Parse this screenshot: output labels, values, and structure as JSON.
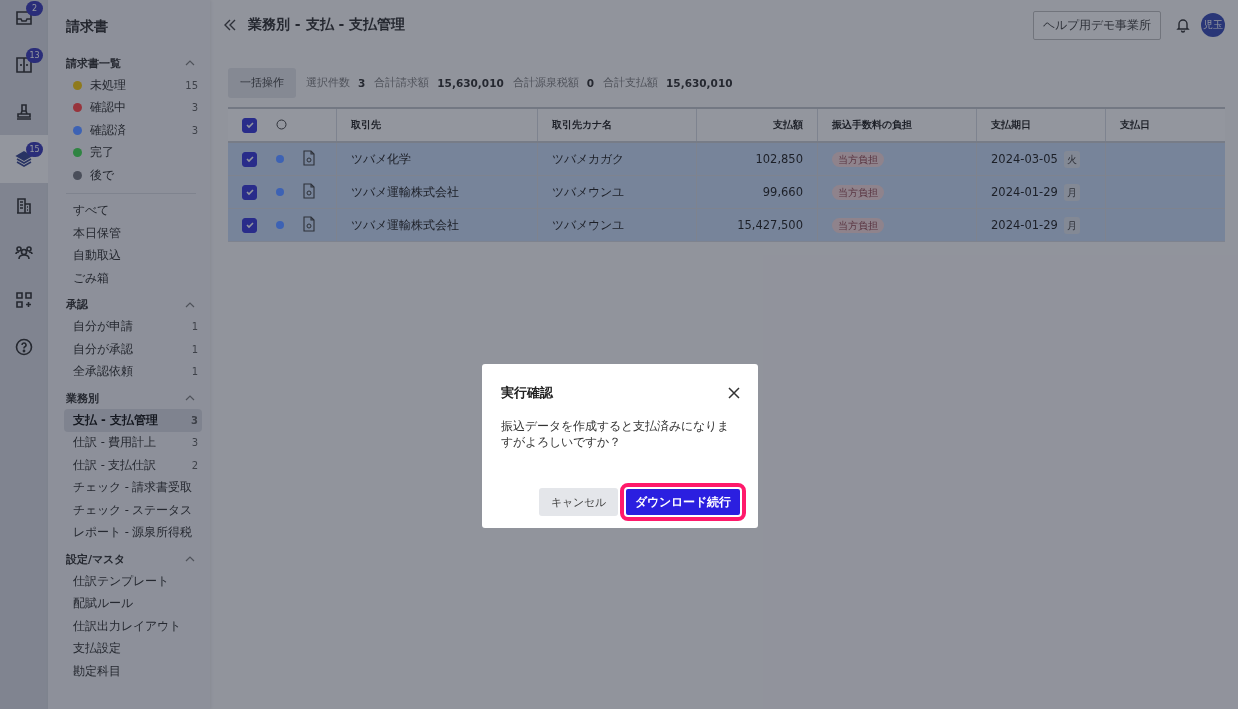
{
  "rail": [
    {
      "badge": "2",
      "selected": false
    },
    {
      "badge": "13",
      "selected": false
    },
    {
      "selected": false
    },
    {
      "badge": "15",
      "selected": true
    },
    {
      "selected": false
    },
    {
      "selected": false
    },
    {
      "selected": false
    },
    {
      "selected": false
    }
  ],
  "sidebar": {
    "title": "請求書",
    "sections": [
      {
        "title": "請求書一覧",
        "expanded": true,
        "items": [
          {
            "kind": "status",
            "label": "未処理",
            "count": "15",
            "color": "#8f7a1c",
            "selected": false
          },
          {
            "kind": "status",
            "label": "確認中",
            "count": "3",
            "color": "#98343c",
            "selected": false
          },
          {
            "kind": "status",
            "label": "確認済",
            "count": "3",
            "color": "#3d62b4",
            "selected": false
          },
          {
            "kind": "status",
            "label": "完了",
            "color": "#2f8442",
            "selected": false
          },
          {
            "kind": "status",
            "label": "後で",
            "color": "#4a4e5a",
            "selected": false
          },
          {
            "kind": "divider"
          },
          {
            "kind": "link",
            "label": "すべて",
            "selected": false
          },
          {
            "kind": "link",
            "label": "本日保管",
            "selected": false
          },
          {
            "kind": "link",
            "label": "自動取込",
            "selected": false
          },
          {
            "kind": "link",
            "label": "ごみ箱",
            "selected": false
          }
        ]
      },
      {
        "title": "承認",
        "expanded": true,
        "items": [
          {
            "kind": "link",
            "label": "自分が申請",
            "count": "1",
            "selected": false
          },
          {
            "kind": "link",
            "label": "自分が承認",
            "count": "1",
            "selected": false
          },
          {
            "kind": "link",
            "label": "全承認依頼",
            "count": "1",
            "selected": false
          }
        ]
      },
      {
        "title": "業務別",
        "expanded": true,
        "items": [
          {
            "kind": "link",
            "label": "支払 - 支払管理",
            "count": "3",
            "selected": true
          },
          {
            "kind": "link",
            "label": "仕訳 - 費用計上",
            "count": "3",
            "selected": false
          },
          {
            "kind": "link",
            "label": "仕訳 - 支払仕訳",
            "count": "2",
            "selected": false
          },
          {
            "kind": "link",
            "label": "チェック - 請求書受取",
            "selected": false
          },
          {
            "kind": "link",
            "label": "チェック - ステータス",
            "selected": false
          },
          {
            "kind": "link",
            "label": "レポート - 源泉所得税",
            "selected": false
          }
        ]
      },
      {
        "title": "設定/マスタ",
        "expanded": true,
        "items": [
          {
            "kind": "link",
            "label": "仕訳テンプレート",
            "selected": false
          },
          {
            "kind": "link",
            "label": "配賦ルール",
            "selected": false
          },
          {
            "kind": "link",
            "label": "仕訳出力レイアウト",
            "selected": false
          },
          {
            "kind": "link",
            "label": "支払設定",
            "selected": false
          },
          {
            "kind": "link",
            "label": "勘定科目",
            "selected": false
          }
        ]
      }
    ]
  },
  "header": {
    "title": "業務別 - 支払 - 支払管理",
    "office": "ヘルプ用デモ事業所",
    "avatar": "児玉"
  },
  "toolbar": {
    "bulk_button": "一括操作",
    "summary": [
      {
        "label": "選択件数",
        "value": "3"
      },
      {
        "label": "合計請求額",
        "value": "15,630,010"
      },
      {
        "label": "合計源泉税額",
        "value": "0"
      },
      {
        "label": "合計支払額",
        "value": "15,630,010"
      }
    ]
  },
  "table": {
    "all_checked": true,
    "columns": [
      "取引先",
      "取引先カナ名",
      "支払額",
      "振込手数料の負担",
      "支払期日",
      "支払日"
    ],
    "rows": [
      {
        "checked": true,
        "selected": true,
        "color": "#3d62b4",
        "partner": "ツバメ化学",
        "kana": "ツバメカガク",
        "amount": "102,850",
        "fee": "当方負担",
        "due": "2024-03-05",
        "weekday": "火"
      },
      {
        "checked": true,
        "selected": true,
        "color": "#3d62b4",
        "partner": "ツバメ運輸株式会社",
        "kana": "ツバメウンユ",
        "amount": "99,660",
        "fee": "当方負担",
        "due": "2024-01-29",
        "weekday": "月"
      },
      {
        "checked": true,
        "selected": true,
        "color": "#3d62b4",
        "partner": "ツバメ運輸株式会社",
        "kana": "ツバメウンユ",
        "amount": "15,427,500",
        "fee": "当方負担",
        "due": "2024-01-29",
        "weekday": "月"
      }
    ]
  },
  "dialog": {
    "title": "実行確認",
    "message": "振込データを作成すると支払済みになりますがよろしいですか？",
    "cancel": "キャンセル",
    "confirm": "ダウンロード続行",
    "confirm_focused": true
  }
}
